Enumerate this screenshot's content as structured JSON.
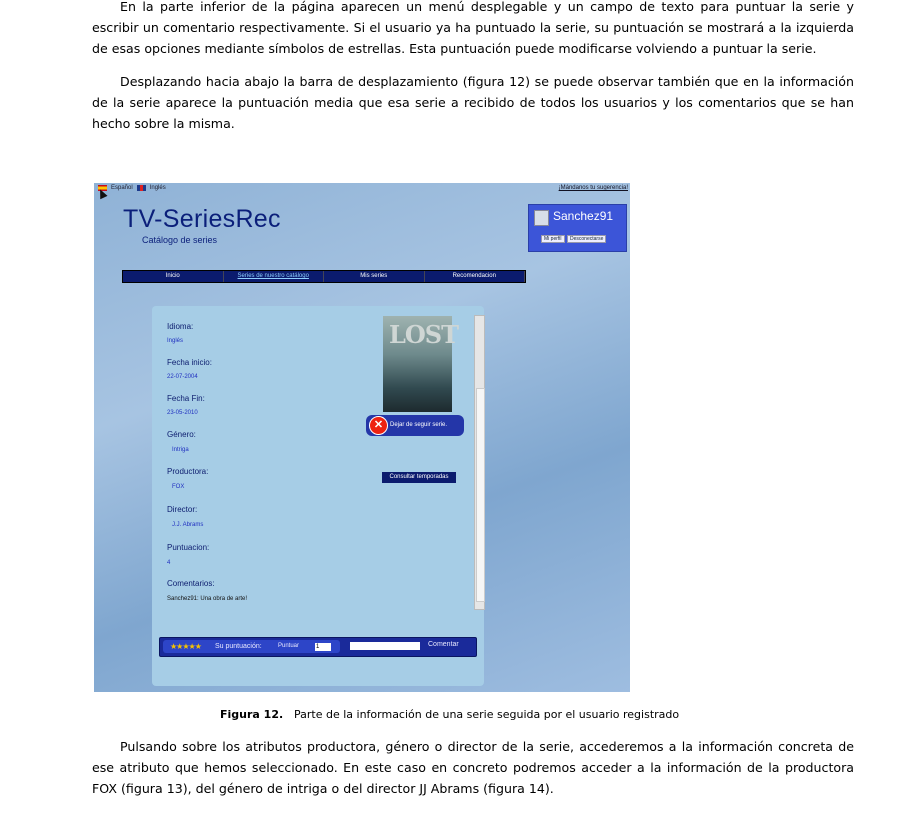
{
  "doc": {
    "p1": "En la parte inferior de la página aparecen un menú desplegable y un campo de texto para puntuar la serie y escribir un comentario respectivamente. Si el usuario ya ha puntuado la serie, su puntuación se mostrará a la izquierda de esas opciones mediante símbolos de estrellas. Esta puntuación puede modificarse volviendo a puntuar la serie.",
    "p2": "Desplazando hacia abajo la barra de desplazamiento (figura 12) se puede observar también que en la información de la serie aparece la puntuación media que esa serie a recibido de todos los usuarios y los comentarios que se han hecho sobre la misma.",
    "p3": "Pulsando sobre los atributos productora, género o director de la serie, accederemos a la información concreta de ese atributo que hemos seleccionado. En este caso en concreto podremos acceder a la información de la productora FOX (figura 13), del género de intriga o del director JJ Abrams (figura 14).",
    "caption_num": "Figura 12.",
    "caption_text": "Parte de la información de una serie seguida por el usuario registrado"
  },
  "app": {
    "lang_es": "Español",
    "lang_en": "Inglés",
    "suggest": "¡Mándanos tu sugerencia!",
    "title": "TV-SeriesRec",
    "subtitle": "Catálogo de series",
    "user": "Sanchez91",
    "profile_btn": "Mi perfil",
    "logout_btn": "Desconectarse",
    "nav": [
      "Inicio",
      "Series de nuestro catálogo",
      "Mis series",
      "Recomendacion"
    ],
    "poster_title": "LOST",
    "fields": [
      {
        "label": "Idioma:",
        "value": "Inglés"
      },
      {
        "label": "Fecha inicio:",
        "value": "22-07-2004"
      },
      {
        "label": "Fecha Fin:",
        "value": "23-05-2010"
      },
      {
        "label": "Género:",
        "value": "Intriga"
      },
      {
        "label": "Productora:",
        "value": "FOX"
      },
      {
        "label": "Director:",
        "value": "J.J. Abrams"
      },
      {
        "label": "Puntuacion:",
        "value": "4"
      },
      {
        "label": "Comentarios:",
        "value": "Sanchez91: Una obra de arte!"
      }
    ],
    "unfollow": "Dejar de seguir serie.",
    "seasons": "Consultar temporadas",
    "stars": "★★★★★",
    "your_rating": "Su puntuación:",
    "rate_btn": "Puntuar",
    "rate_value": "1",
    "comment_btn": "Comentar"
  }
}
